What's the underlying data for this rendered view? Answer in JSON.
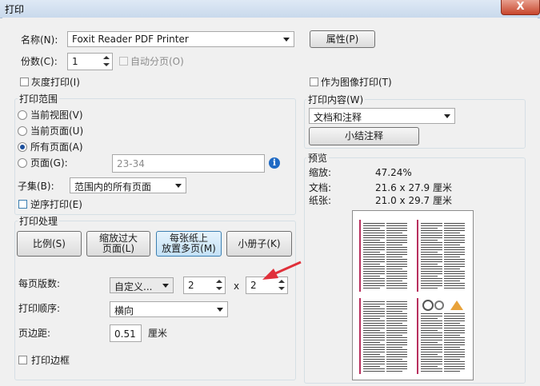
{
  "window": {
    "title": "打印",
    "close_label": "X"
  },
  "printer": {
    "name_label": "名称(N):",
    "name_value": "Foxit Reader PDF Printer",
    "properties_button": "属性(P)",
    "copies_label": "份数(C):",
    "copies_value": "1",
    "collate_label": "自动分页(O)",
    "grayscale_label": "灰度打印(I)",
    "print_as_image_label": "作为图像打印(T)"
  },
  "range": {
    "group_label": "打印范围",
    "current_view": "当前视图(V)",
    "current_page": "当前页面(U)",
    "all_pages": "所有页面(A)",
    "pages": "页面(G):",
    "pages_value": "23-34",
    "subset_label": "子集(B):",
    "subset_value": "范围内的所有页面",
    "reverse_label": "逆序打印(E)"
  },
  "handling": {
    "group_label": "打印处理",
    "buttons": {
      "scale": "比例(S)",
      "shrink_line1": "缩放过大",
      "shrink_line2": "页面(L)",
      "multi_line1": "每张纸上",
      "multi_line2": "放置多页(M)",
      "booklet": "小册子(K)"
    },
    "pages_per_sheet_label": "每页版数:",
    "pages_per_sheet_value": "自定义...",
    "cols_value": "2",
    "times": "x",
    "rows_value": "2",
    "order_label": "打印顺序:",
    "order_value": "横向",
    "margin_label": "页边距:",
    "margin_value": "0.51",
    "margin_unit": "厘米",
    "border_label": "打印边框"
  },
  "content": {
    "group_label": "打印内容(W)",
    "value": "文档和注释",
    "summarize_button": "小结注释"
  },
  "preview": {
    "group_label": "预览",
    "zoom_label": "缩放:",
    "zoom_value": "47.24%",
    "doc_label": "文档:",
    "doc_value": "21.6 x 27.9 厘米",
    "paper_label": "纸张:",
    "paper_value": "21.0 x 29.7 厘米"
  },
  "colors": {
    "accent": "#1b4f9c",
    "arrow": "#e0303a"
  }
}
